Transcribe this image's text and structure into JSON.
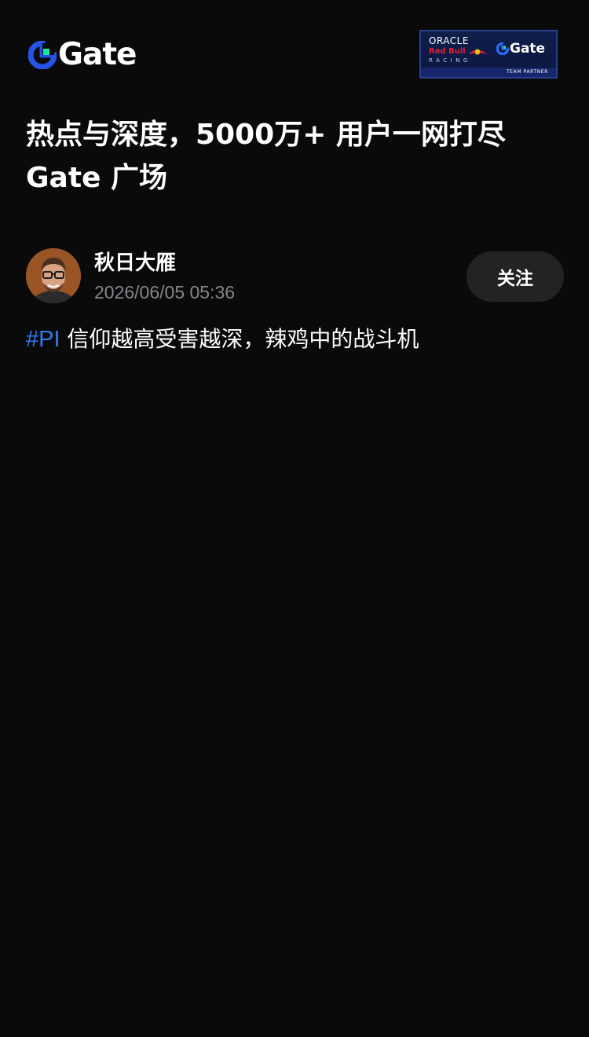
{
  "header": {
    "logo_text": "Gate",
    "brand_color": "#2354e6",
    "brand_accent": "#17e6a1",
    "partner_badge": {
      "oracle": "ORACLE",
      "redbull": "Red Bull",
      "racing": "RACING",
      "gate": "Gate",
      "strip": "TEAM PARTNER"
    }
  },
  "title": "热点与深度，5000万+ 用户一网打尽 Gate 广场",
  "author": {
    "name": "秋日大雁",
    "time": "2026/06/05 05:36",
    "avatar_icon": "avatar-photo-icon"
  },
  "follow_label": "关注",
  "post": {
    "hashtag": "#PI",
    "text": " 信仰越高受害越深，辣鸡中的战斗机"
  },
  "colors": {
    "background": "#0a0a0a",
    "hashtag": "#2f7bf5",
    "muted_text": "#84868c",
    "button_bg": "#222325"
  }
}
